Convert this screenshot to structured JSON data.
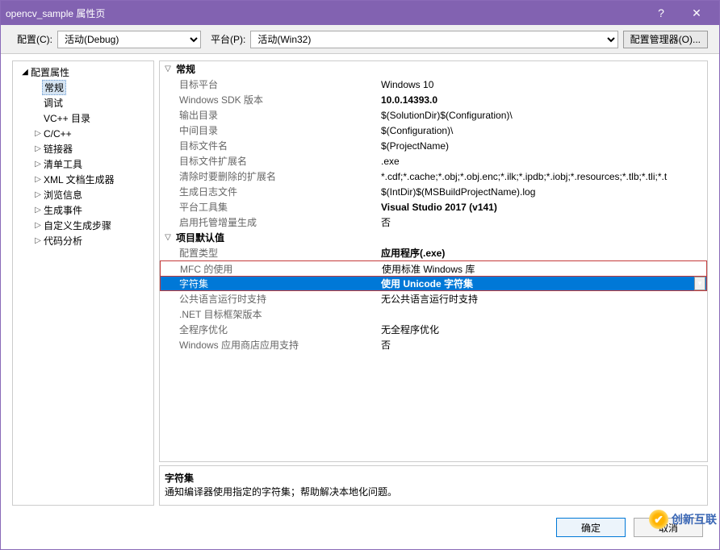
{
  "title": "opencv_sample 属性页",
  "help_icon": "?",
  "close_icon": "✕",
  "toolbar": {
    "config_label": "配置(C):",
    "config_value": "活动(Debug)",
    "platform_label": "平台(P):",
    "platform_value": "活动(Win32)",
    "manager_btn": "配置管理器(O)..."
  },
  "tree": {
    "root": "配置属性",
    "items": [
      {
        "label": "常规",
        "expander": false,
        "selected": true
      },
      {
        "label": "调试",
        "expander": false
      },
      {
        "label": "VC++ 目录",
        "expander": false
      },
      {
        "label": "C/C++",
        "expander": true
      },
      {
        "label": "链接器",
        "expander": true
      },
      {
        "label": "清单工具",
        "expander": true
      },
      {
        "label": "XML 文档生成器",
        "expander": true
      },
      {
        "label": "浏览信息",
        "expander": true
      },
      {
        "label": "生成事件",
        "expander": true
      },
      {
        "label": "自定义生成步骤",
        "expander": true
      },
      {
        "label": "代码分析",
        "expander": true
      }
    ]
  },
  "grid": {
    "sections": [
      {
        "label": "常规",
        "rows": [
          {
            "key": "目标平台",
            "value": "Windows 10"
          },
          {
            "key": "Windows SDK 版本",
            "value": "10.0.14393.0",
            "bold": true
          },
          {
            "key": "输出目录",
            "value": "$(SolutionDir)$(Configuration)\\"
          },
          {
            "key": "中间目录",
            "value": "$(Configuration)\\"
          },
          {
            "key": "目标文件名",
            "value": "$(ProjectName)"
          },
          {
            "key": "目标文件扩展名",
            "value": ".exe"
          },
          {
            "key": "清除时要删除的扩展名",
            "value": "*.cdf;*.cache;*.obj;*.obj.enc;*.ilk;*.ipdb;*.iobj;*.resources;*.tlb;*.tli;*.t"
          },
          {
            "key": "生成日志文件",
            "value": "$(IntDir)$(MSBuildProjectName).log"
          },
          {
            "key": "平台工具集",
            "value": "Visual Studio 2017 (v141)",
            "bold": true
          },
          {
            "key": "启用托管增量生成",
            "value": "否"
          }
        ]
      },
      {
        "label": "项目默认值",
        "rows": [
          {
            "key": "配置类型",
            "value": "应用程序(.exe)",
            "bold": true
          },
          {
            "key": "MFC 的使用",
            "value": "使用标准 Windows 库"
          },
          {
            "key": "字符集",
            "value": "使用 Unicode 字符集",
            "selected": true,
            "dropdown": true
          },
          {
            "key": "公共语言运行时支持",
            "value": "无公共语言运行时支持"
          },
          {
            "key": ".NET 目标框架版本",
            "value": ""
          },
          {
            "key": "全程序优化",
            "value": "无全程序优化"
          },
          {
            "key": "Windows 应用商店应用支持",
            "value": "否"
          }
        ]
      }
    ]
  },
  "description": {
    "title": "字符集",
    "text": "通知编译器使用指定的字符集；帮助解决本地化问题。"
  },
  "buttons": {
    "ok": "确定",
    "cancel": "取消"
  },
  "watermark": "创新互联"
}
